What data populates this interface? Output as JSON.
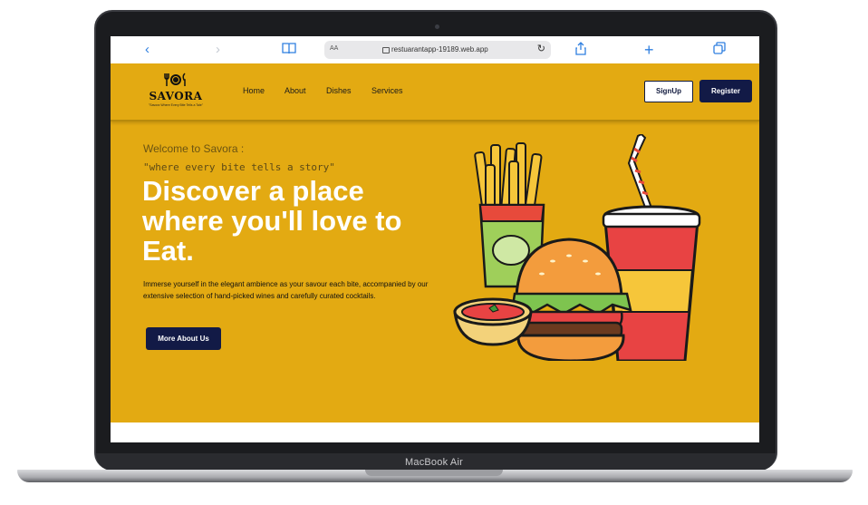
{
  "device": {
    "label": "MacBook Air"
  },
  "browser": {
    "text_size_label": "AA",
    "url": "restuarantapp-19189.web.app",
    "icons": [
      "back-icon",
      "forward-icon",
      "reader-icon",
      "lock-icon",
      "reload-icon",
      "share-icon",
      "new-tab-icon",
      "tabs-icon"
    ]
  },
  "site": {
    "logo": {
      "name": "SAVORA",
      "tagline": "\"Savora Where Every Bite Tells a Tale\""
    },
    "nav": {
      "home": "Home",
      "about": "About",
      "dishes": "Dishes",
      "services": "Services"
    },
    "auth": {
      "signup": "SignUp",
      "register": "Register"
    },
    "hero": {
      "welcome": "Welcome to Savora :",
      "story": "\"where every bite tells a story\"",
      "headline": "Discover a place where you'll love to Eat.",
      "description": "Immerse yourself in the elegant ambience as your savour each bite, accompanied by our extensive selection of hand-picked wines and carefully curated cocktails.",
      "cta": "More About Us"
    },
    "colors": {
      "background": "#e3aa12",
      "primary": "#121a46",
      "headline": "#ffffff"
    }
  }
}
